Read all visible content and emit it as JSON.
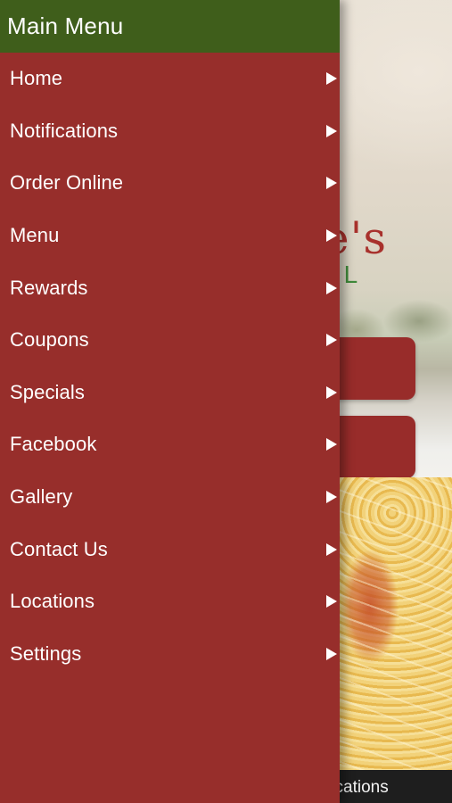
{
  "drawer": {
    "title": "Main Menu",
    "items": [
      {
        "label": "Home",
        "icon": "chevron-right-icon"
      },
      {
        "label": "Notifications",
        "icon": "chevron-right-icon"
      },
      {
        "label": "Order Online",
        "icon": "chevron-right-icon"
      },
      {
        "label": "Menu",
        "icon": "chevron-right-icon"
      },
      {
        "label": "Rewards",
        "icon": "chevron-right-icon"
      },
      {
        "label": "Coupons",
        "icon": "chevron-right-icon"
      },
      {
        "label": "Specials",
        "icon": "chevron-right-icon"
      },
      {
        "label": "Facebook",
        "icon": "chevron-right-icon"
      },
      {
        "label": "Gallery",
        "icon": "chevron-right-icon"
      },
      {
        "label": "Contact Us",
        "icon": "chevron-right-icon"
      },
      {
        "label": "Locations",
        "icon": "chevron-right-icon"
      },
      {
        "label": "Settings",
        "icon": "chevron-right-icon"
      }
    ]
  },
  "background": {
    "logo_partial": "e's",
    "logo_sub_partial": "LL",
    "tabbar_partial_label": "fications"
  },
  "colors": {
    "header_green": "#3f5e1b",
    "drawer_red": "#972e2b",
    "text_white": "#ffffff"
  }
}
